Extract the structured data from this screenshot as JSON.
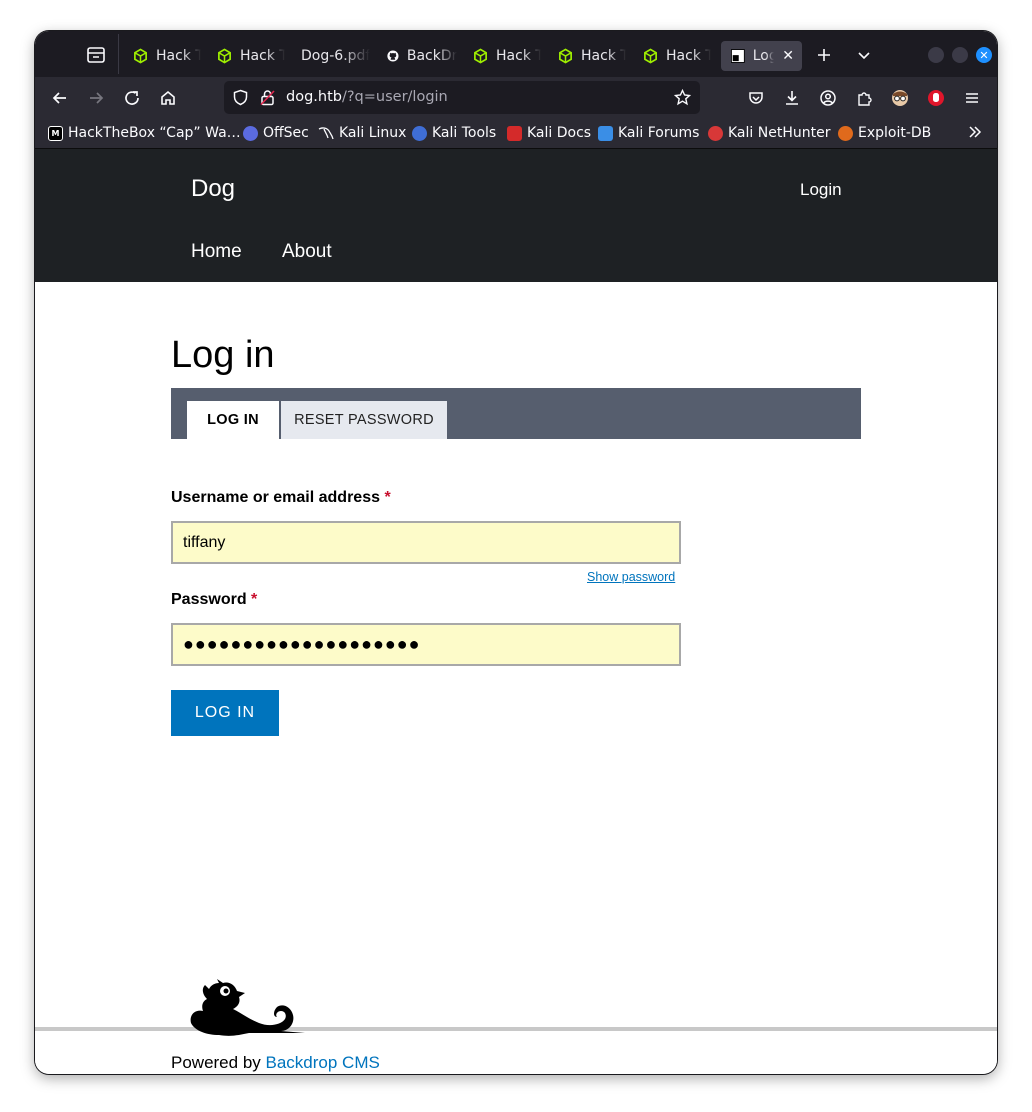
{
  "browser": {
    "tabs": [
      {
        "title": "Hack T",
        "icon": "htb-cube-icon"
      },
      {
        "title": "Hack T",
        "icon": "htb-cube-icon"
      },
      {
        "title": "Dog-6.pdf",
        "icon": ""
      },
      {
        "title": "BackDrop",
        "icon": "github-icon"
      },
      {
        "title": "Hack T",
        "icon": "htb-cube-icon"
      },
      {
        "title": "Hack T",
        "icon": "htb-cube-icon"
      },
      {
        "title": "Hack T",
        "icon": "htb-cube-icon"
      },
      {
        "title": "Log",
        "icon": "backdrop-favicon",
        "active": true
      }
    ],
    "url_host": "dog.htb",
    "url_path": "/?q=user/login",
    "bookmarks": [
      {
        "label": "HackTheBox “Cap” Wa…",
        "icon": "medium-icon"
      },
      {
        "label": "OffSec",
        "icon": "offsec-icon"
      },
      {
        "label": "Kali Linux",
        "icon": "kali-dragon-icon"
      },
      {
        "label": "Kali Tools",
        "icon": "kali-tools-icon"
      },
      {
        "label": "Kali Docs",
        "icon": "kali-docs-icon"
      },
      {
        "label": "Kali Forums",
        "icon": "kali-forums-icon"
      },
      {
        "label": "Kali NetHunter",
        "icon": "nethunter-icon"
      },
      {
        "label": "Exploit-DB",
        "icon": "exploit-db-icon"
      }
    ],
    "colors": {
      "htb_green": "#9fef00",
      "accent_blue": "#1e90ff"
    }
  },
  "site": {
    "name": "Dog",
    "login_link": "Login",
    "menu": [
      "Home",
      "About"
    ]
  },
  "main": {
    "title": "Log in",
    "tabs": [
      "LOG IN",
      "RESET PASSWORD"
    ],
    "username_label": "Username or email address",
    "username_value": "tiffany",
    "password_label": "Password",
    "password_mask": "●●●●●●●●●●●●●●●●●●●●",
    "required_mark": "*",
    "show_password": "Show password",
    "submit": "LOG IN"
  },
  "footer": {
    "powered_prefix": "Powered by",
    "powered_link": "Backdrop CMS"
  }
}
